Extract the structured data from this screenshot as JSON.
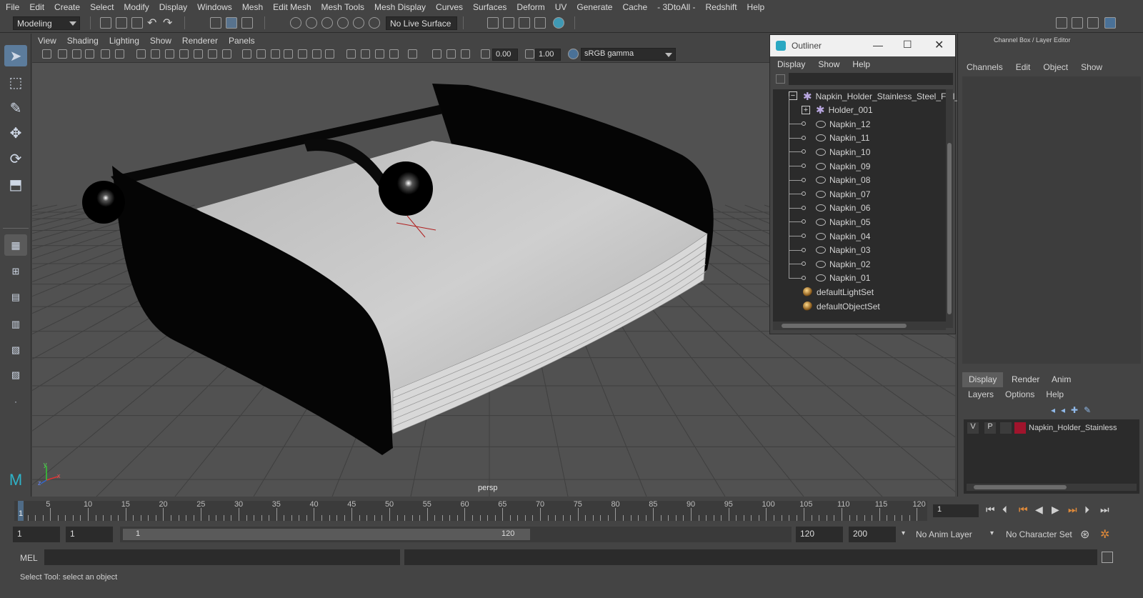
{
  "menubar": [
    "File",
    "Edit",
    "Create",
    "Select",
    "Modify",
    "Display",
    "Windows",
    "Mesh",
    "Edit Mesh",
    "Mesh Tools",
    "Mesh Display",
    "Curves",
    "Surfaces",
    "Deform",
    "UV",
    "Generate",
    "Cache",
    "- 3DtoAll -",
    "Redshift",
    "Help"
  ],
  "toolbar": {
    "mode": "Modeling",
    "live_surface": "No Live Surface"
  },
  "viewport": {
    "menu": [
      "View",
      "Shading",
      "Lighting",
      "Show",
      "Renderer",
      "Panels"
    ],
    "exposure": "0.00",
    "gamma": "1.00",
    "colorspace": "sRGB gamma",
    "camera": "persp",
    "axis_x": "x",
    "axis_y": "y",
    "axis_z": "z"
  },
  "outliner": {
    "title": "Outliner",
    "menu": [
      "Display",
      "Show",
      "Help"
    ],
    "items": [
      {
        "label": "Napkin_Holder_Stainless_Steel_Full_",
        "type": "group"
      },
      {
        "label": "Holder_001",
        "type": "group"
      },
      {
        "label": "Napkin_12",
        "type": "mesh"
      },
      {
        "label": "Napkin_11",
        "type": "mesh"
      },
      {
        "label": "Napkin_10",
        "type": "mesh"
      },
      {
        "label": "Napkin_09",
        "type": "mesh"
      },
      {
        "label": "Napkin_08",
        "type": "mesh"
      },
      {
        "label": "Napkin_07",
        "type": "mesh"
      },
      {
        "label": "Napkin_06",
        "type": "mesh"
      },
      {
        "label": "Napkin_05",
        "type": "mesh"
      },
      {
        "label": "Napkin_04",
        "type": "mesh"
      },
      {
        "label": "Napkin_03",
        "type": "mesh"
      },
      {
        "label": "Napkin_02",
        "type": "mesh"
      },
      {
        "label": "Napkin_01",
        "type": "mesh"
      },
      {
        "label": "defaultLightSet",
        "type": "set"
      },
      {
        "label": "defaultObjectSet",
        "type": "set"
      }
    ]
  },
  "channelbox": {
    "title": "Channel Box / Layer Editor",
    "menu": [
      "Channels",
      "Edit",
      "Object",
      "Show"
    ],
    "tabs": [
      "Display",
      "Render",
      "Anim"
    ],
    "layer_menu": [
      "Layers",
      "Options",
      "Help"
    ],
    "layer": {
      "v": "V",
      "p": "P",
      "name": "Napkin_Holder_Stainless",
      "color": "#a0142c"
    }
  },
  "timeline": {
    "ticks": [
      "5",
      "10",
      "15",
      "20",
      "25",
      "30",
      "35",
      "40",
      "45",
      "50",
      "55",
      "60",
      "65",
      "70",
      "75",
      "80",
      "85",
      "90",
      "95",
      "100",
      "105",
      "110",
      "115",
      "120"
    ],
    "current_frame": "1",
    "frame_field": "1"
  },
  "range": {
    "start": "1",
    "start2": "1",
    "slider_start": "1",
    "slider_end": "120",
    "end": "120",
    "end2": "200",
    "anim_layer": "No Anim Layer",
    "char_set": "No Character Set"
  },
  "command": {
    "label": "MEL"
  },
  "help": {
    "text": "Select Tool: select an object"
  }
}
